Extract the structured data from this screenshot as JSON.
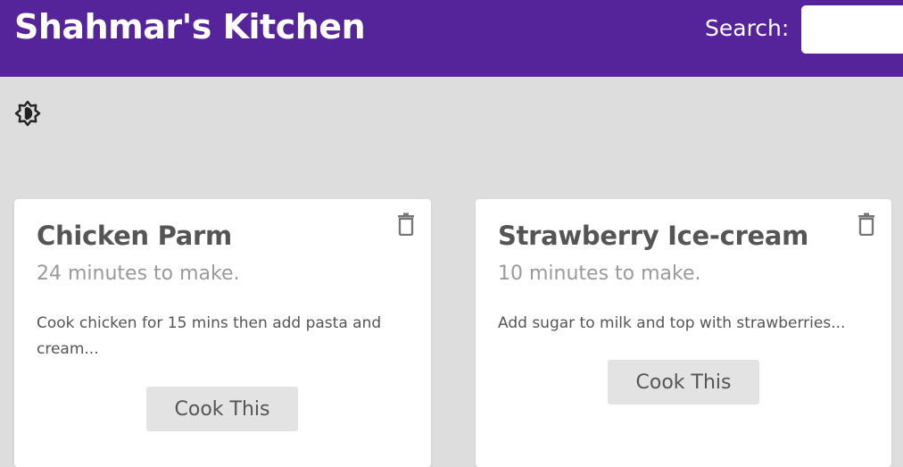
{
  "header": {
    "title": "Shahmar's Kitchen",
    "search_label": "Search:",
    "search_value": ""
  },
  "theme_toggle": {
    "icon": "brightness-icon"
  },
  "recipes": [
    {
      "title": "Chicken Parm",
      "time": "24 minutes to make.",
      "description": "Cook chicken for 15 mins then add pasta and cream...",
      "button": "Cook This",
      "delete_icon": "trash-icon"
    },
    {
      "title": "Strawberry Ice-cream",
      "time": "10 minutes to make.",
      "description": "Add sugar to milk and top with strawberries...",
      "button": "Cook This",
      "delete_icon": "trash-icon"
    }
  ],
  "colors": {
    "header_bg": "#55249b",
    "page_bg": "#dddddd",
    "card_bg": "#ffffff",
    "button_bg": "#e3e3e3"
  }
}
